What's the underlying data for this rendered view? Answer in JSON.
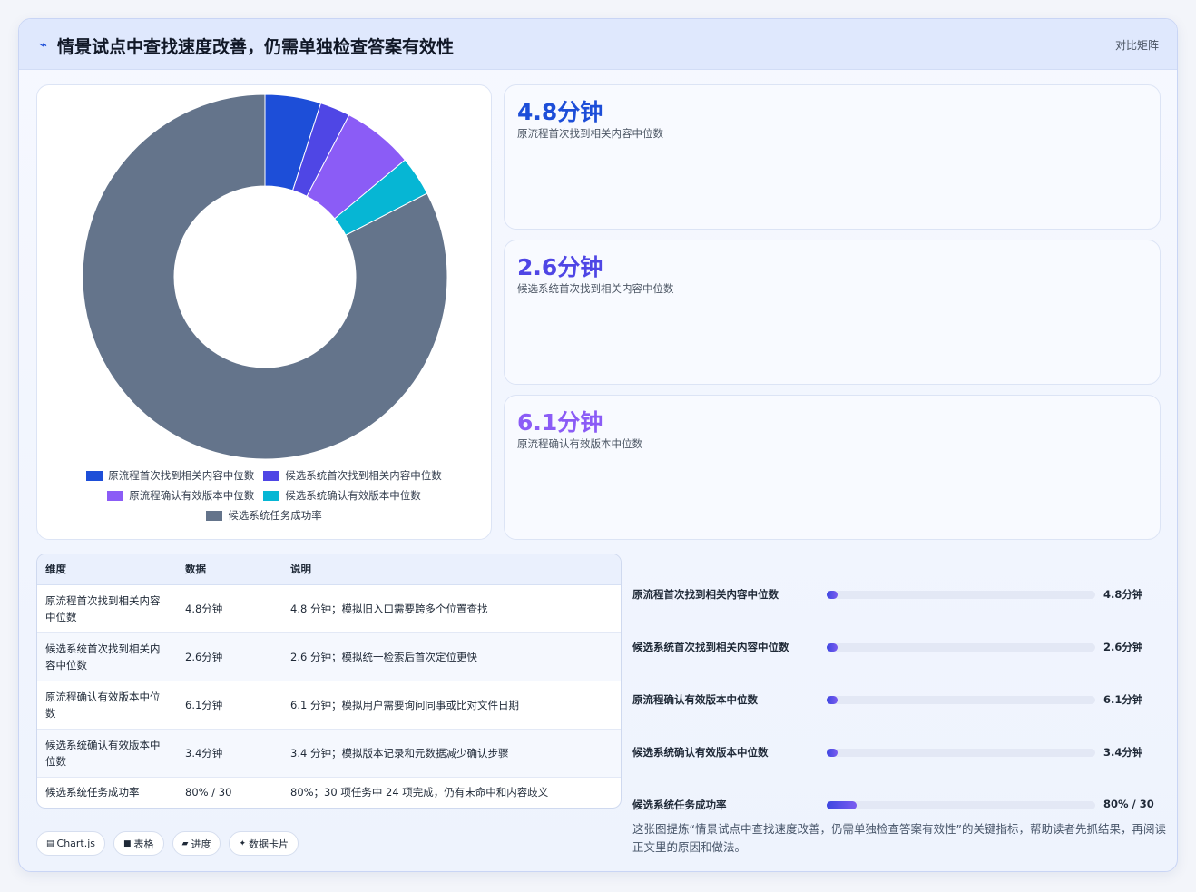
{
  "header": {
    "title": "情景试点中查找速度改善，仍需单独检查答案有效性",
    "badge": "对比矩阵"
  },
  "chart_data": {
    "type": "pie",
    "categories": [
      "原流程首次找到相关内容中位数",
      "候选系统首次找到相关内容中位数",
      "原流程确认有效版本中位数",
      "候选系统确认有效版本中位数",
      "候选系统任务成功率"
    ],
    "values": [
      4.8,
      2.6,
      6.1,
      3.4,
      80
    ],
    "colors": [
      "#1d4ed8",
      "#4f46e5",
      "#8b5cf6",
      "#06b6d4",
      "#64748b"
    ],
    "donut": true,
    "legend_position": "bottom"
  },
  "kpis": [
    {
      "value": "4.8分钟",
      "label": "原流程首次找到相关内容中位数",
      "color": "#1d4ed8"
    },
    {
      "value": "2.6分钟",
      "label": "候选系统首次找到相关内容中位数",
      "color": "#4f46e5"
    },
    {
      "value": "6.1分钟",
      "label": "原流程确认有效版本中位数",
      "color": "#8b5cf6"
    }
  ],
  "table": {
    "headers": [
      "维度",
      "数据",
      "说明"
    ],
    "rows": [
      [
        "原流程首次找到相关内容中位数",
        "4.8分钟",
        "4.8 分钟；模拟旧入口需要跨多个位置查找"
      ],
      [
        "候选系统首次找到相关内容中位数",
        "2.6分钟",
        "2.6 分钟；模拟统一检索后首次定位更快"
      ],
      [
        "原流程确认有效版本中位数",
        "6.1分钟",
        "6.1 分钟；模拟用户需要询问同事或比对文件日期"
      ],
      [
        "候选系统确认有效版本中位数",
        "3.4分钟",
        "3.4 分钟；模拟版本记录和元数据减少确认步骤"
      ],
      [
        "候选系统任务成功率",
        "80% / 30",
        "80%；30 项任务中 24 项完成，仍有未命中和内容歧义"
      ]
    ]
  },
  "progress": [
    {
      "label": "原流程首次找到相关内容中位数",
      "value": "4.8分钟",
      "fraction": 0.04
    },
    {
      "label": "候选系统首次找到相关内容中位数",
      "value": "2.6分钟",
      "fraction": 0.04
    },
    {
      "label": "原流程确认有效版本中位数",
      "value": "6.1分钟",
      "fraction": 0.04
    },
    {
      "label": "候选系统确认有效版本中位数",
      "value": "3.4分钟",
      "fraction": 0.04
    },
    {
      "label": "候选系统任务成功率",
      "value": "80% / 30",
      "fraction": 0.11
    }
  ],
  "caption": "这张图提炼“情景试点中查找速度改善，仍需单独检查答案有效性”的关键指标，帮助读者先抓结果，再阅读正文里的原因和做法。",
  "chips": [
    {
      "icon": "▤",
      "label": "Chart.js"
    },
    {
      "icon": "■",
      "label": "表格"
    },
    {
      "icon": "▰",
      "label": "进度"
    },
    {
      "icon": "✦",
      "label": "数据卡片"
    }
  ]
}
